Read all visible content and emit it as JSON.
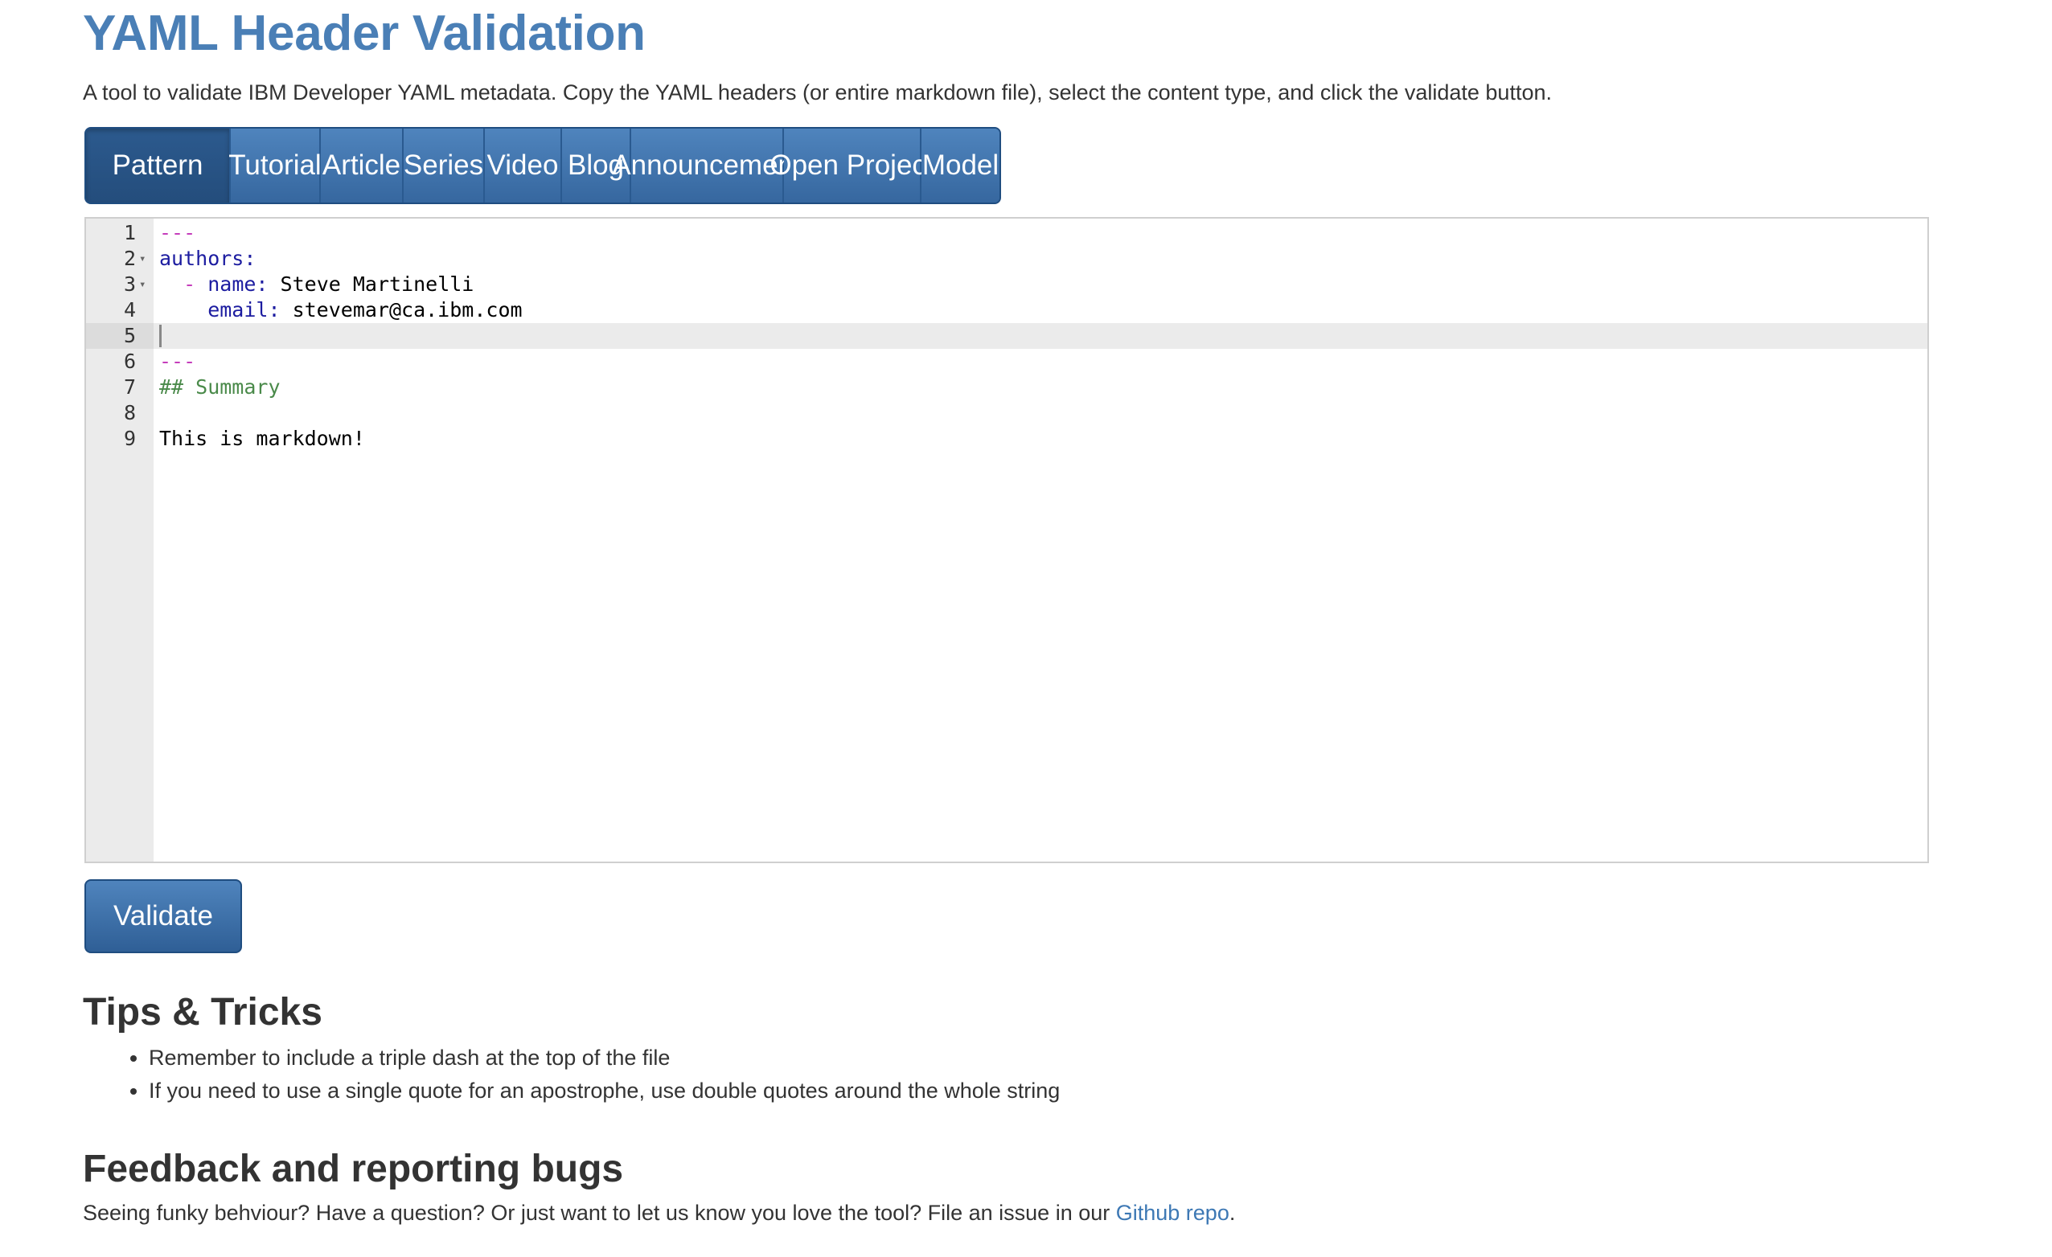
{
  "page": {
    "title": "YAML Header Validation",
    "intro": "A tool to validate IBM Developer YAML metadata. Copy the YAML headers (or entire markdown file), select the content type, and click the validate button."
  },
  "tabs": [
    {
      "label": "Pattern",
      "active": true
    },
    {
      "label": "Tutorial",
      "active": false
    },
    {
      "label": "Article",
      "active": false
    },
    {
      "label": "Series",
      "active": false
    },
    {
      "label": "Video",
      "active": false
    },
    {
      "label": "Blog",
      "active": false
    },
    {
      "label": "Announcement",
      "active": false
    },
    {
      "label": "Open Project",
      "active": false
    },
    {
      "label": "Model",
      "active": false
    }
  ],
  "editor": {
    "active_line": 5,
    "lines": [
      {
        "num": "1",
        "fold": false,
        "tokens": [
          {
            "t": "dash",
            "v": "---"
          }
        ]
      },
      {
        "num": "2",
        "fold": true,
        "tokens": [
          {
            "t": "key",
            "v": "authors:"
          }
        ]
      },
      {
        "num": "3",
        "fold": true,
        "tokens": [
          {
            "t": "dash",
            "v": "  - "
          },
          {
            "t": "key",
            "v": "name:"
          },
          {
            "t": "val",
            "v": " Steve Martinelli"
          }
        ]
      },
      {
        "num": "4",
        "fold": false,
        "tokens": [
          {
            "t": "key",
            "v": "    email:"
          },
          {
            "t": "val",
            "v": " stevemar@ca.ibm.com"
          }
        ]
      },
      {
        "num": "5",
        "fold": false,
        "tokens": []
      },
      {
        "num": "6",
        "fold": false,
        "tokens": [
          {
            "t": "dash",
            "v": "---"
          }
        ]
      },
      {
        "num": "7",
        "fold": false,
        "tokens": [
          {
            "t": "comment",
            "v": "## Summary"
          }
        ]
      },
      {
        "num": "8",
        "fold": false,
        "tokens": []
      },
      {
        "num": "9",
        "fold": false,
        "tokens": [
          {
            "t": "val",
            "v": "This is markdown!"
          }
        ]
      }
    ]
  },
  "validate_button": {
    "label": "Validate"
  },
  "tips": {
    "heading": "Tips & Tricks",
    "items": [
      "Remember to include a triple dash at the top of the file",
      "If you need to use a single quote for an apostrophe, use double quotes around the whole string"
    ]
  },
  "feedback": {
    "heading": "Feedback and reporting bugs",
    "text_before": "Seeing funky behviour? Have a question? Or just want to let us know you love the tool? File an issue in our ",
    "link_text": "Github repo",
    "text_after": "."
  },
  "colors": {
    "title": "#4a7fb6",
    "tab_bg": "#3f74ad",
    "tab_active_bg": "#2a578a",
    "link": "#3d78b4",
    "yaml_dash": "#c53dbb",
    "yaml_key": "#1c1ca0",
    "md_comment": "#4a8a4a"
  }
}
